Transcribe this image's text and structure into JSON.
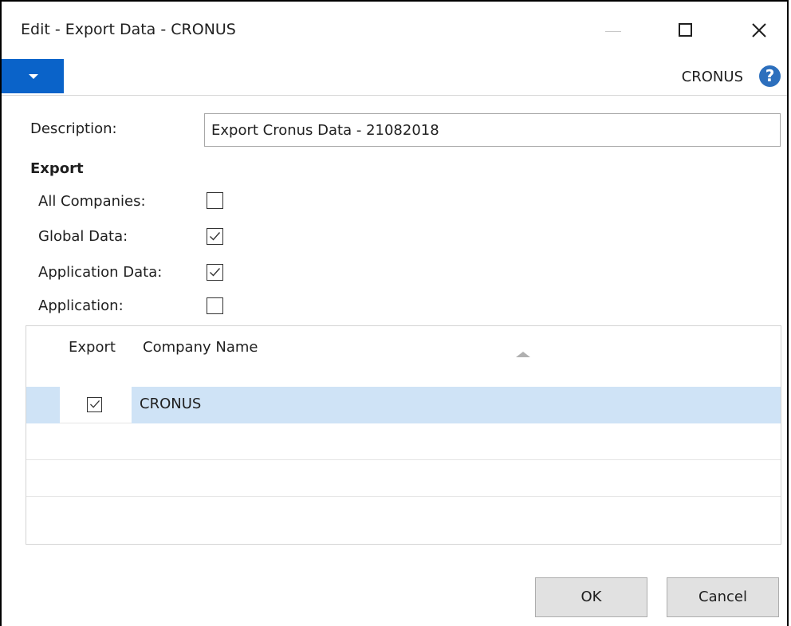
{
  "window": {
    "title": "Edit - Export Data - CRONUS"
  },
  "actionbar": {
    "company": "CRONUS",
    "help": "?"
  },
  "form": {
    "description_label": "Description:",
    "description_value": "Export Cronus Data - 21082018",
    "export_section": "Export",
    "fields": [
      {
        "label": "All Companies:",
        "checked": false
      },
      {
        "label": "Global Data:",
        "checked": true
      },
      {
        "label": "Application Data:",
        "checked": true
      },
      {
        "label": "Application:",
        "checked": false
      }
    ]
  },
  "grid": {
    "columns": [
      "Export",
      "Company Name"
    ],
    "rows": [
      {
        "export": true,
        "name": "CRONUS",
        "selected": true
      }
    ]
  },
  "buttons": {
    "ok": "OK",
    "cancel": "Cancel"
  },
  "colors": {
    "accent": "#0a63c9",
    "selection": "#cfe3f6",
    "help": "#2c6fbd"
  },
  "icons": {
    "menu": "dropdown-arrow-icon",
    "help": "help-icon",
    "sort": "sort-ascending-icon",
    "close": "close-icon",
    "maximize": "maximize-icon",
    "minimize": "minimize-icon"
  }
}
